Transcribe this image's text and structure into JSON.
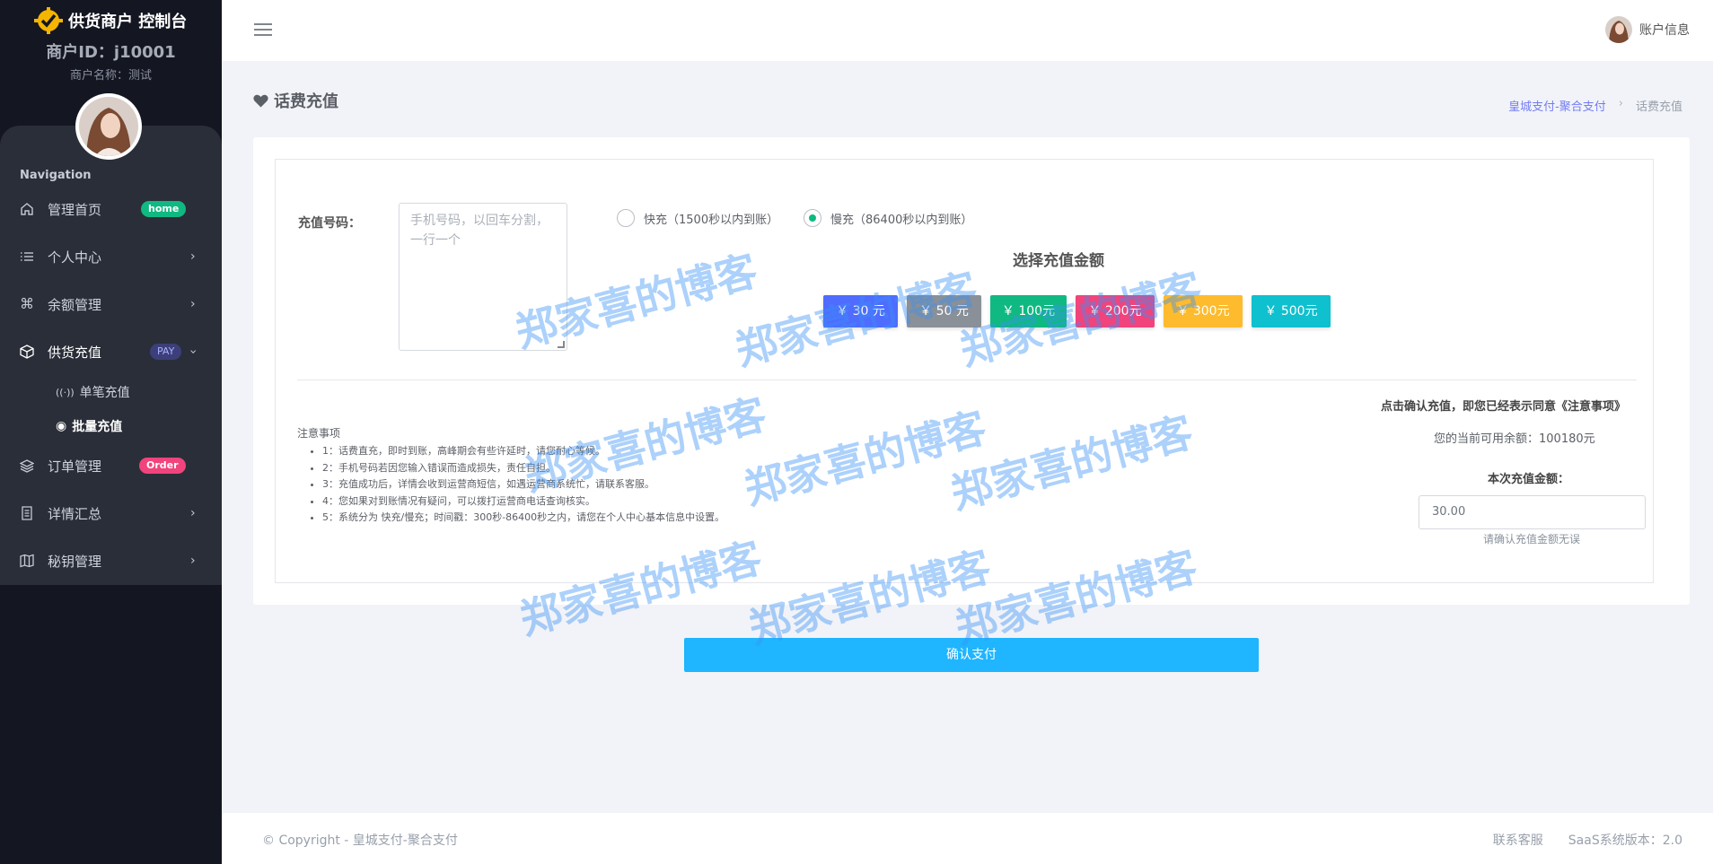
{
  "brand": {
    "title": "供货商户 控制台"
  },
  "merchant": {
    "id": "商户ID：j10001",
    "name": "商户名称：测试"
  },
  "nav": {
    "caption": "Navigation",
    "items": [
      {
        "label": "管理首页",
        "badge": "home"
      },
      {
        "label": "个人中心"
      },
      {
        "label": "余额管理"
      },
      {
        "label": "供货充值",
        "badge": "PAY"
      },
      {
        "label": "订单管理",
        "badge": "Order"
      },
      {
        "label": "详情汇总"
      },
      {
        "label": "秘钥管理"
      }
    ],
    "sub_items": [
      {
        "label": "单笔充值"
      },
      {
        "label": "批量充值"
      }
    ]
  },
  "topbar": {
    "account": "账户信息"
  },
  "page": {
    "title": "话费充值"
  },
  "breadcrumb": {
    "link": "皇城支付-聚合支付",
    "separator": "›",
    "current": "话费充值"
  },
  "form": {
    "phone_label": "充值号码：",
    "phone_placeholder": "手机号码，以回车分割，一行一个",
    "radios": [
      {
        "label": "快充（1500秒以内到账）",
        "checked": false
      },
      {
        "label": "慢充（86400秒以内到账）",
        "checked": true
      }
    ],
    "amount_title": "选择充值金额",
    "amounts": [
      {
        "label": "￥ 30 元",
        "color": "#4f6cff"
      },
      {
        "label": "￥ 50 元",
        "color": "#8a9098"
      },
      {
        "label": "￥ 100元",
        "color": "#10b981"
      },
      {
        "label": "￥ 200元",
        "color": "#f1437c"
      },
      {
        "label": "￥ 300元",
        "color": "#fdbb2d"
      },
      {
        "label": "￥ 500元",
        "color": "#0fc0cf"
      }
    ]
  },
  "notes": {
    "title": "注意事项",
    "items": [
      "1：话费直充，即时到账，高峰期会有些许延时，请您耐心等候。",
      "2：手机号码若因您输入错误而造成损失，责任自担。",
      "3：充值成功后，详情会收到运营商短信，如遇运营商系统忙，请联系客服。",
      "4：您如果对到账情况有疑问，可以拨打运营商电话查询核实。",
      "5：系统分为 快充/慢充；时间戳：300秒-86400秒之内，请您在个人中心基本信息中设置。"
    ]
  },
  "summary": {
    "agree": "点击确认充值，即您已经表示同意《注意事项》",
    "balance": "您的当前可用余额：100180元",
    "amount_label": "本次充值金额：",
    "amount_value": "30.00",
    "amount_hint": "请确认充值金额无误"
  },
  "pay_button": "确认支付",
  "watermark": "郑家喜的博客",
  "footer": {
    "copyright": "© Copyright - 皇城支付-聚合支付",
    "contact": "联系客服",
    "version": "SaaS系统版本：2.0"
  },
  "colors": {
    "sidebar": "#141722",
    "accent": "#1fb5ff",
    "link": "#727cf5",
    "home_badge": "#10b981",
    "pay_badge": "#3d3f7a",
    "order_badge": "#f1437c"
  }
}
